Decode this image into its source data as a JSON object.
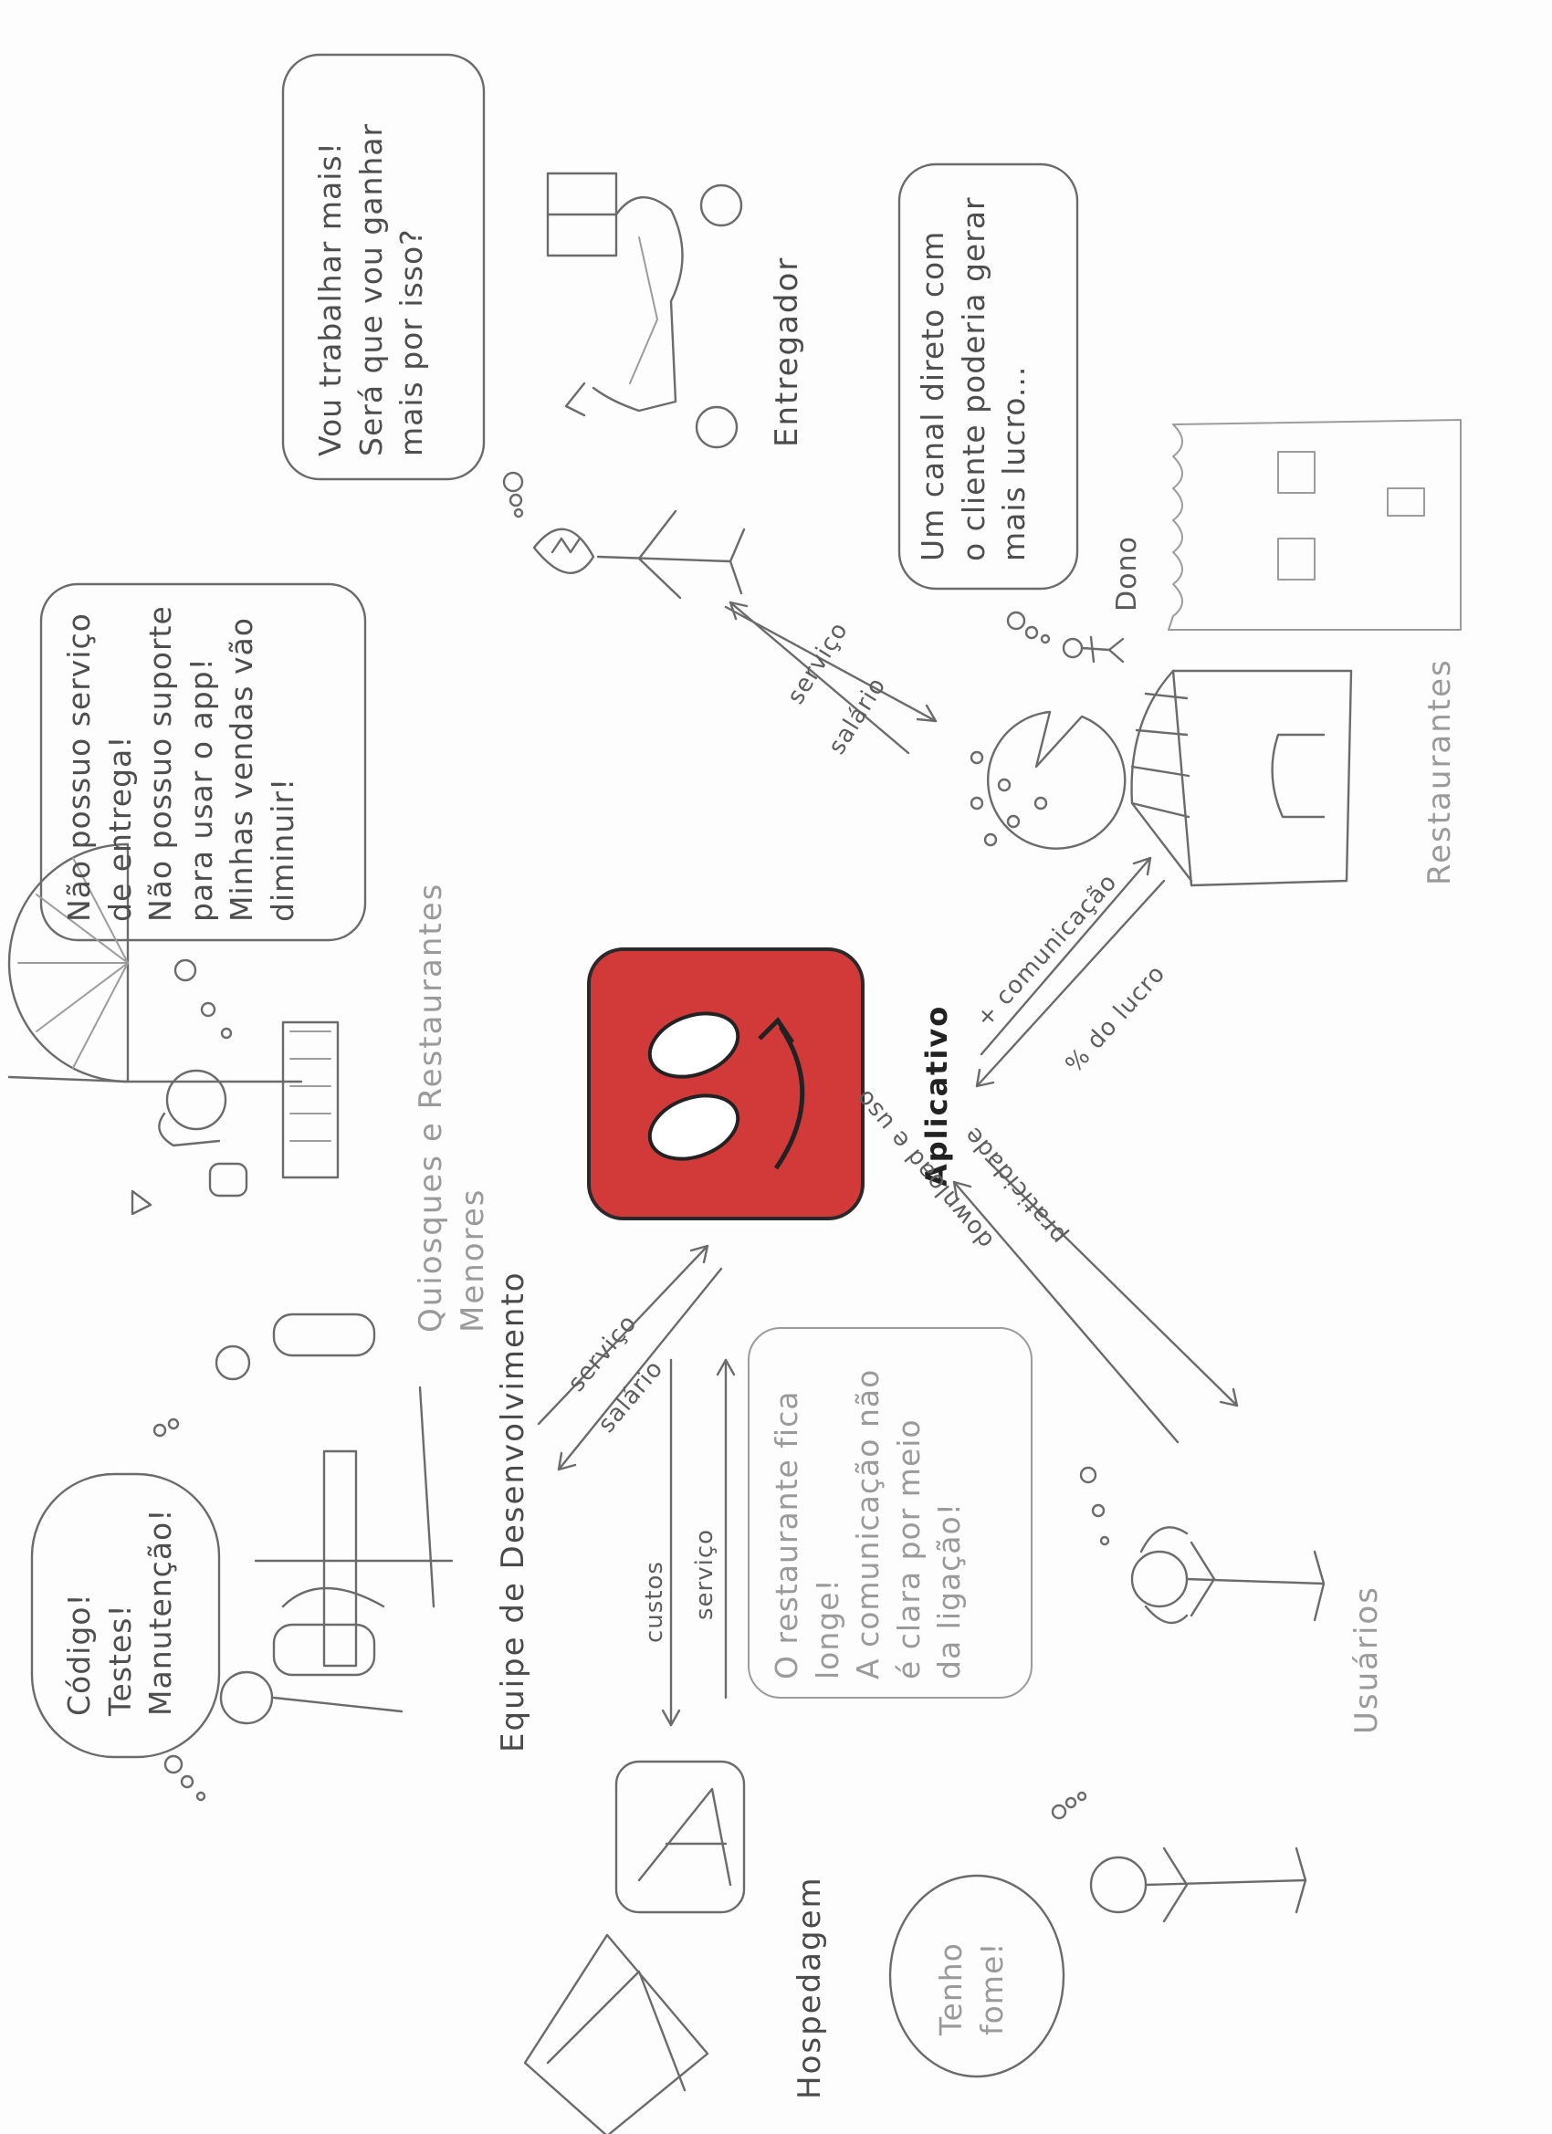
{
  "center": {
    "label": "Aplicativo",
    "icon_color": "#d23a3a",
    "icon": "app-face-icon"
  },
  "stakeholders": {
    "entregador": {
      "label": "Entregador",
      "bubble": "Vou trabalhar mais!\nSerá que vou ganhar\nmais por isso?",
      "arrow_to_app": "serviço",
      "arrow_from_app": "salário"
    },
    "restaurantes": {
      "label": "Restaurantes",
      "owner_label": "Dono",
      "bubble": "Um canal direto com\no cliente poderia gerar\nmais lucro...",
      "arrow_to_app": "+ comunicação",
      "arrow_from_app": "% do lucro"
    },
    "quiosques": {
      "label": "Quiosques e Restaurantes\nMenores",
      "bubble": "Não possuo serviço\nde entrega!\nNão possuo suporte\npara usar o app!\nMinhas vendas vão\ndiminuir!"
    },
    "equipe": {
      "label": "Equipe de Desenvolvimento",
      "bubble": "Código!\nTestes!\nManutenção!",
      "arrow_to_app": "serviço",
      "arrow_from_app": "salário"
    },
    "hospedagem": {
      "label": "Hospedagem",
      "arrow_to_app": "serviço",
      "arrow_from_app": "custos"
    },
    "usuarios": {
      "label": "Usuários",
      "bubble_top": "O restaurante fica\nlonge!\nA comunicação não\né clara por meio\nda ligação!",
      "bubble_bottom": "Tenho\nfome!",
      "arrow_to_app": "download e uso",
      "arrow_from_app": "praticidade"
    }
  }
}
